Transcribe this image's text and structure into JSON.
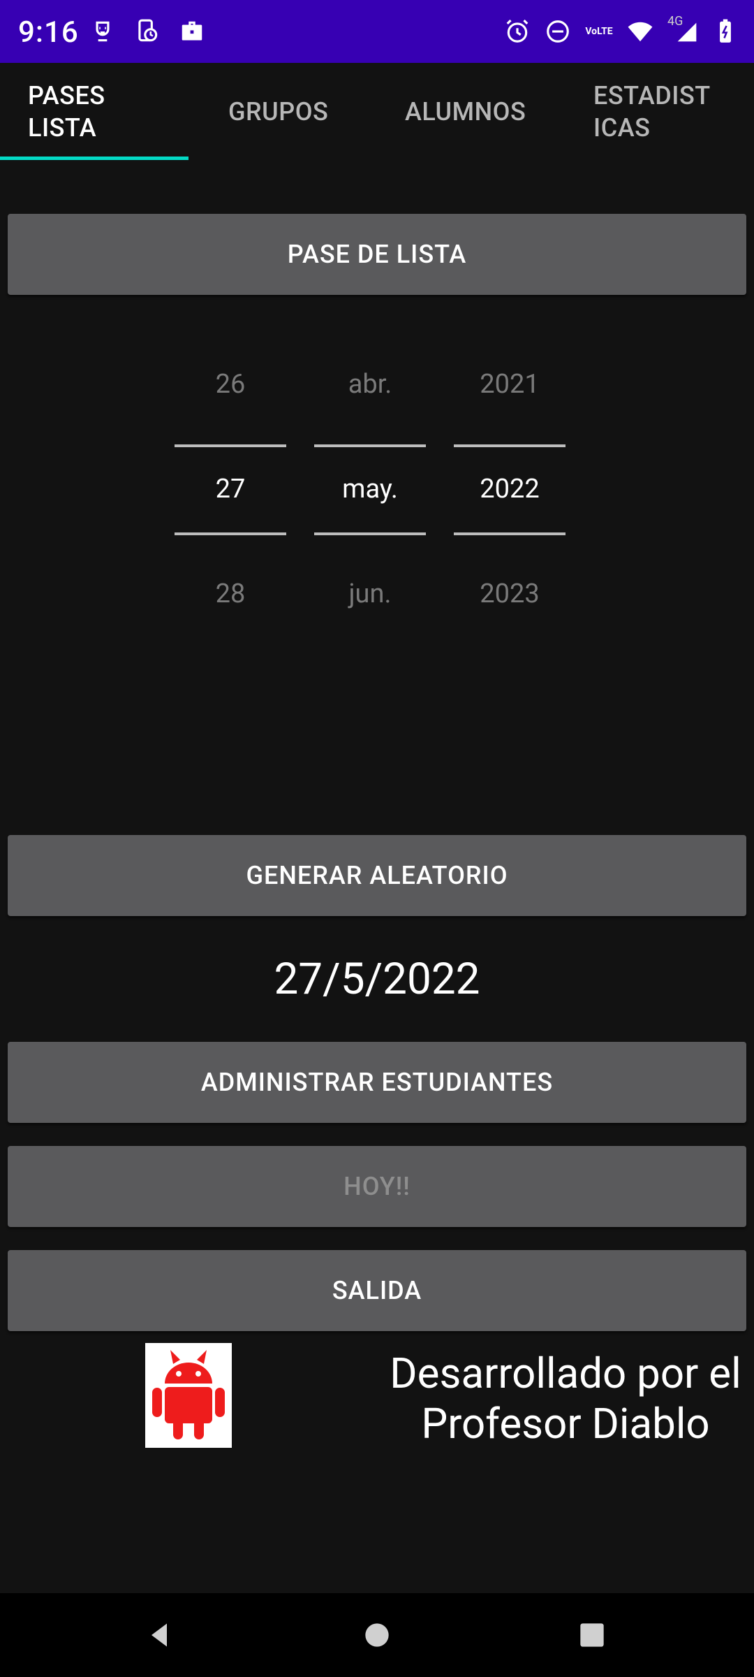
{
  "status_bar": {
    "time": "9:16",
    "left_icons": [
      "face-icon",
      "phone-sync-icon",
      "briefcase-icon"
    ],
    "right_icons": [
      "alarm-icon",
      "do-not-disturb-icon",
      "volte-icon",
      "wifi-icon",
      "signal-4g-icon",
      "battery-icon"
    ],
    "network_label": "4G",
    "volte_label": "VoLTE",
    "background": "#3700b3"
  },
  "tabs": [
    {
      "label": "PASES\nLISTA",
      "active": true
    },
    {
      "label": "GRUPOS",
      "active": false
    },
    {
      "label": "ALUMNOS",
      "active": false
    },
    {
      "label": "ESTADIST\nICAS",
      "active": false
    }
  ],
  "tab_indicator_color": "#03dac5",
  "buttons": {
    "pase_de_lista": "PASE DE LISTA",
    "generar_aleatorio": "GENERAR ALEATORIO",
    "administrar": "ADMINISTRAR ESTUDIANTES",
    "hoy": "HOY!!",
    "salida": "SALIDA"
  },
  "date_picker": {
    "day": {
      "prev": "26",
      "current": "27",
      "next": "28"
    },
    "month": {
      "prev": "abr.",
      "current": "may.",
      "next": "jun."
    },
    "year": {
      "prev": "2021",
      "current": "2022",
      "next": "2023"
    }
  },
  "selected_date": "27/5/2022",
  "credit": "Desarrollado por el Profesor Diablo",
  "logo_icon": "red-devil-android-icon",
  "nav": [
    "back-icon",
    "home-icon",
    "recents-icon"
  ]
}
